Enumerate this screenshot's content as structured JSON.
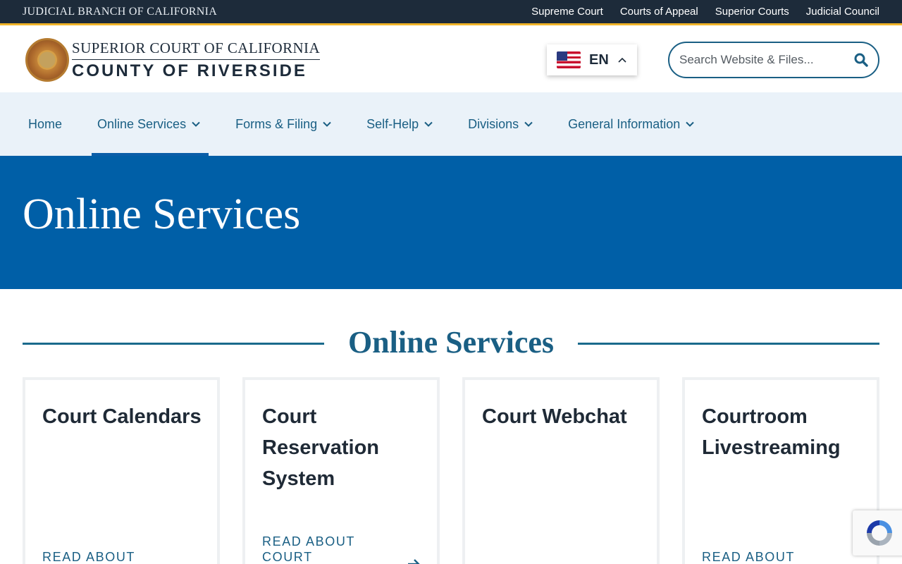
{
  "utility_bar": {
    "brand": "JUDICIAL BRANCH OF CALIFORNIA",
    "links": [
      "Supreme Court",
      "Courts of Appeal",
      "Superior Courts",
      "Judicial Council"
    ]
  },
  "header": {
    "logo_line1": "SUPERIOR COURT OF CALIFORNIA",
    "logo_line2": "COUNTY OF RIVERSIDE",
    "language": {
      "code": "EN",
      "flag_icon": "us-flag-icon"
    },
    "search": {
      "placeholder": "Search Website & Files..."
    }
  },
  "nav": {
    "items": [
      {
        "label": "Home",
        "has_dropdown": false,
        "active": false
      },
      {
        "label": "Online Services",
        "has_dropdown": true,
        "active": true
      },
      {
        "label": "Forms & Filing",
        "has_dropdown": true,
        "active": false
      },
      {
        "label": "Self-Help",
        "has_dropdown": true,
        "active": false
      },
      {
        "label": "Divisions",
        "has_dropdown": true,
        "active": false
      },
      {
        "label": "General Information",
        "has_dropdown": true,
        "active": false
      }
    ]
  },
  "hero": {
    "title": "Online Services"
  },
  "section": {
    "title": "Online Services"
  },
  "cards": [
    {
      "title": "Court Calendars",
      "link": "READ ABOUT"
    },
    {
      "title": "Court Reservation System",
      "link": "READ ABOUT COURT"
    },
    {
      "title": "Court Webchat",
      "link": ""
    },
    {
      "title": "Courtroom Livestreaming",
      "link": "READ ABOUT"
    }
  ],
  "colors": {
    "utility_bg": "#1d2b3a",
    "accent_gold": "#f0b429",
    "nav_bg": "#eaf2f9",
    "hero_bg": "#005fa7",
    "link_blue": "#1a5f84"
  }
}
